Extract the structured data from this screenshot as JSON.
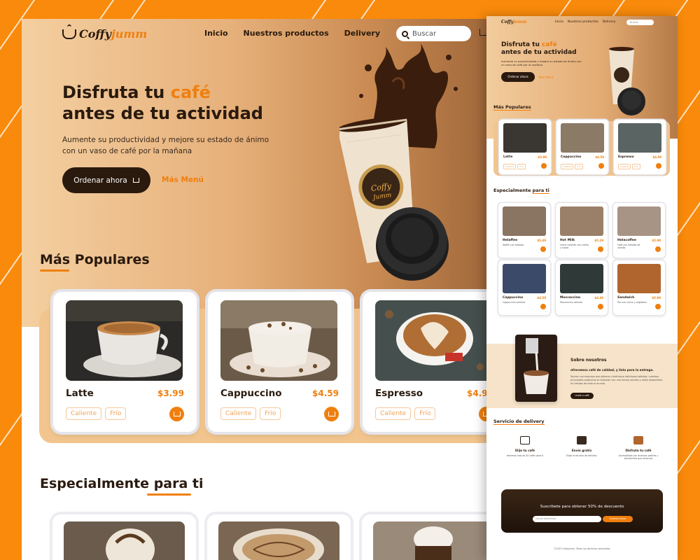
{
  "brand": {
    "logo_main": "Coffy",
    "logo_accent": "jumm",
    "accent_color": "#f07f0e",
    "dark_color": "#2a1a0e",
    "background_color": "#f98a0b"
  },
  "nav": {
    "links": [
      "Inicio",
      "Nuestros productos",
      "Delivery"
    ],
    "search_placeholder": "Buscar"
  },
  "hero": {
    "title_part1": "Disfruta tu ",
    "title_accent": "café",
    "title_part2": "antes de tu actividad",
    "subtitle": "Aumente su productividad y mejore su estado de ánimo con un vaso de café por la mañana",
    "order_button": "Ordenar ahora",
    "more_link": "Más Menú"
  },
  "popular": {
    "title": "Más Populares",
    "items": [
      {
        "name": "Latte",
        "price": "$3.99",
        "tags": [
          "Caliente",
          "Frío"
        ]
      },
      {
        "name": "Cappuccino",
        "price": "$4.59",
        "tags": [
          "Caliente",
          "Frío"
        ]
      },
      {
        "name": "Espresso",
        "price": "$4.99",
        "tags": [
          "Caliente",
          "Frío"
        ]
      }
    ]
  },
  "special": {
    "title_part1": "Especialmente ",
    "title_part2": "para ti",
    "items": [
      {
        "name": "Helaffee",
        "price": "$5.49",
        "desc": "Waffle con helados"
      },
      {
        "name": "Hot Milk",
        "price": "$5.29",
        "desc": "Leche caliente con crema y cacao"
      },
      {
        "name": "Helacoffee",
        "price": "$5.99",
        "desc": "Café con helados de vainilla"
      },
      {
        "name": "Cappuccino",
        "price": "$4.59",
        "desc": "Cappuccino caliente"
      },
      {
        "name": "Moccaccino",
        "price": "$4.49",
        "desc": "Moccaccino caliente"
      },
      {
        "name": "Sandwich",
        "price": "$5.99",
        "desc": "Pan con carne y vegetales"
      }
    ]
  },
  "about": {
    "title": "Sobre nosotros",
    "subtitle": "ofrecemos café de calidad, y listo para la entrega.",
    "description": "Somos una empresa que elabora y distribuye deliciosas bebidas; nuestros principales productos se elaboran con una receta secreta y están disponibles en tiendas de todo el mundo.",
    "button": "Unete a café"
  },
  "delivery": {
    "title": "Servicio de delivery",
    "items": [
      {
        "title": "Elije tu café",
        "desc": "tenemos más de 20 cafés para ti"
      },
      {
        "title": "Envío gratis",
        "desc": "Elige el servicio de delivery"
      },
      {
        "title": "Disfruta tu café",
        "desc": "Acompáñalo con diversos postres y sandwiches que tenemos"
      }
    ]
  },
  "subscribe": {
    "title": "Suscribete para obtener 50% de descuento",
    "input_placeholder": "Correo electrónico",
    "button": "Ordenar ahora"
  },
  "footer": {
    "copyright": "©2023 Coffyjumm. Todos los derechos reservados"
  }
}
